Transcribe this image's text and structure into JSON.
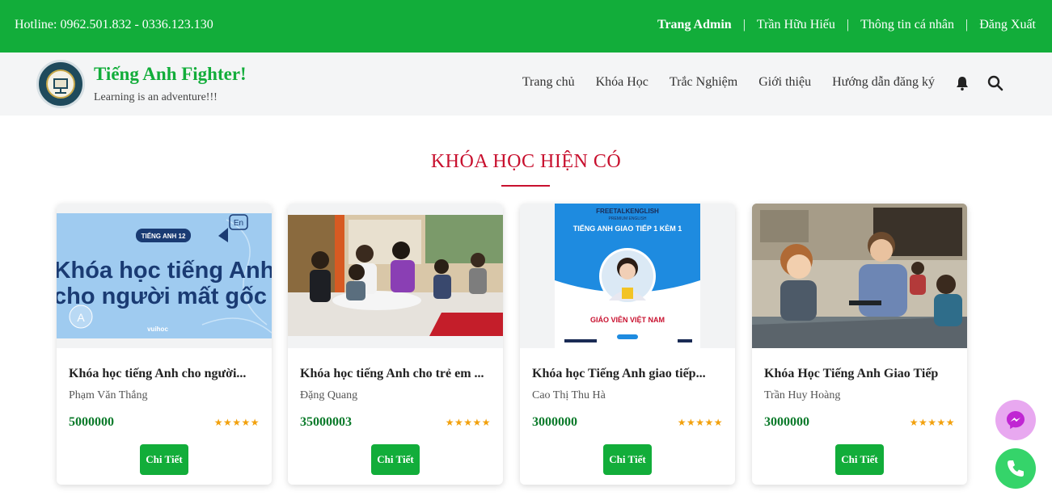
{
  "topbar": {
    "hotline": "Hotline: 0962.501.832 - 0336.123.130",
    "admin_link": "Trang Admin",
    "user_name": "Trần Hữu Hiếu",
    "profile_link": "Thông tin cá nhân",
    "logout_link": "Đăng Xuất",
    "separator": "|",
    "background_color": "#12ad3a"
  },
  "header": {
    "logo_icon": "english-class-logo",
    "logo_text_top": "ENGLISH CLASS",
    "logo_text_bottom": "TIẾNG ANH FIGHTER",
    "brand_title": "Tiếng Anh Fighter!",
    "brand_subtitle": "Learning is an adventure!!!",
    "menu": [
      "Trang chủ",
      "Khóa Học",
      "Trắc Nghiệm",
      "Giới thiệu",
      "Hướng dẫn đăng ký"
    ],
    "bell_icon": "bell-icon",
    "search_icon": "search-icon"
  },
  "section": {
    "title": "KHÓA HỌC HIỆN CÓ",
    "accent_color": "#c8102e"
  },
  "courses": [
    {
      "title": "Khóa học tiếng Anh cho người...",
      "teacher": "Phạm Văn Thắng",
      "price": "5000000",
      "stars": "★★★★★",
      "button": "Chi Tiết",
      "image": {
        "tag": "TIẾNG ANH 12",
        "line1": "Khóa học tiếng Anh",
        "line2": "cho người mất gốc",
        "brand": "vuihoc",
        "icon_en": "En",
        "icon_a": "A"
      }
    },
    {
      "title": "Khóa học tiếng Anh cho trẻ em ...",
      "teacher": "Đặng Quang",
      "price": "35000003",
      "stars": "★★★★★",
      "button": "Chi Tiết",
      "image": {
        "description_icon": "classroom-photo"
      }
    },
    {
      "title": "Khóa học Tiếng Anh giao tiếp...",
      "teacher": "Cao Thị Thu Hà",
      "price": "3000000",
      "stars": "★★★★★",
      "button": "Chi Tiết",
      "image": {
        "brand": "FREETALKENGLISH",
        "brand_sub": "PREMIUM ENGLISH",
        "headline": "TIẾNG ANH GIAO TIẾP 1 KÈM 1",
        "footer": "GIÁO VIÊN VIỆT NAM"
      }
    },
    {
      "title": "Khóa Học Tiếng Anh Giao Tiếp",
      "teacher": "Trần Huy Hoàng",
      "price": "3000000",
      "stars": "★★★★★",
      "button": "Chi Tiết",
      "image": {
        "description_icon": "tutor-photo"
      }
    }
  ],
  "floating": {
    "messenger_icon": "messenger-icon",
    "phone_icon": "phone-icon"
  }
}
